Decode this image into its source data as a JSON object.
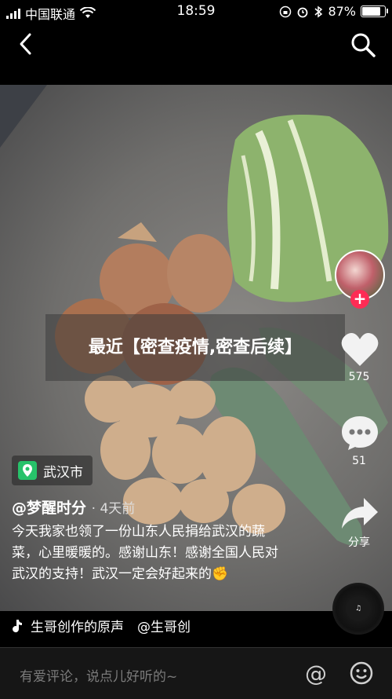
{
  "status_bar": {
    "carrier": "中国联通",
    "time": "18:59",
    "battery": "87%",
    "battery_level": 0.87
  },
  "video": {
    "title": "最近【密查疫情,密查后续】"
  },
  "sidebar": {
    "likes": "575",
    "comments": "51",
    "share_label": "分享",
    "follow_symbol": "+"
  },
  "post": {
    "location": "武汉市",
    "author": "@梦醒时分",
    "time": "· 4天前",
    "description": "今天我家也领了一份山东人民捐给武汉的蔬菜，心里暖暖的。感谢山东！感谢全国人民对武汉的支持！武汉一定会好起来的✊",
    "music": "生哥创作的原声　@生哥创"
  },
  "comment_bar": {
    "placeholder": "有爱评论，说点儿好听的~"
  },
  "icons": [
    "back-icon",
    "search-icon",
    "heart-icon",
    "comment-icon",
    "share-icon",
    "location-pin-icon",
    "music-note-icon",
    "at-icon",
    "emoji-icon"
  ]
}
